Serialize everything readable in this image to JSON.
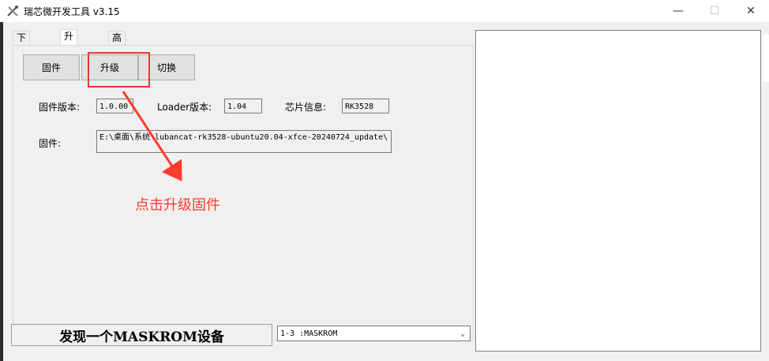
{
  "window": {
    "title": "瑞芯微开发工具 v3.15",
    "minimize_glyph": "—",
    "maximize_glyph": "☐",
    "close_glyph": "✕"
  },
  "tabs": [
    {
      "label": "下载镜像",
      "active": false
    },
    {
      "label": "升级固件",
      "active": true
    },
    {
      "label": "高级功能",
      "active": false
    }
  ],
  "buttons": {
    "firmware": "固件",
    "upgrade": "升级",
    "switch": "切换"
  },
  "info": {
    "firmware_version_label": "固件版本:",
    "firmware_version": "1.0.00",
    "loader_version_label": "Loader版本:",
    "loader_version": "1.04",
    "chip_info_label": "芯片信息:",
    "chip_info": "RK3528",
    "firmware_label": "固件:",
    "firmware_path": "E:\\桌面\\系统\\lubancat-rk3528-ubuntu20.04-xfce-20240724_update\\"
  },
  "annotation": {
    "text": "点击升级固件",
    "color": "#ff3b30"
  },
  "status": {
    "message": "发现一个MASKROM设备"
  },
  "device_select": {
    "value": "1-3 :MASKROM"
  },
  "colors": {
    "accent_red": "#e53935",
    "panel_bg": "#f0f0f0"
  }
}
